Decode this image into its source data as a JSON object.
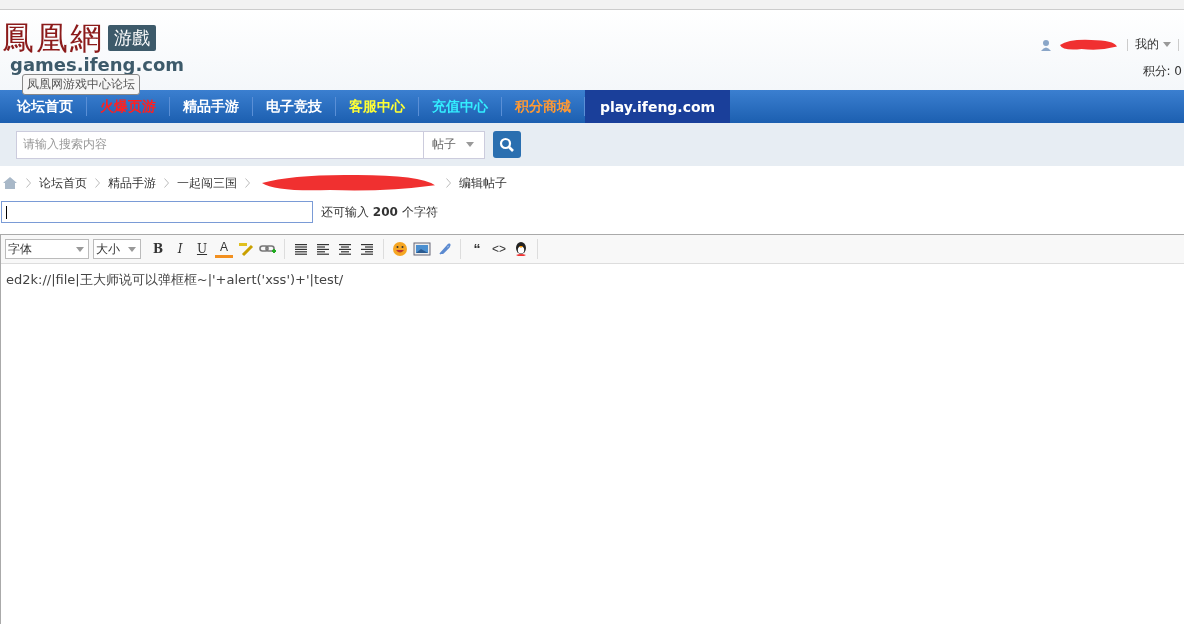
{
  "header": {
    "logo": {
      "name": "鳳凰網",
      "badge": "游戲",
      "domain": "games.ifeng.com"
    },
    "tooltip": "凤凰网游戏中心论坛",
    "user_menu": {
      "label": "我的"
    },
    "points": "积分: 0"
  },
  "nav": [
    {
      "label": "论坛首页",
      "color": "#ffffff",
      "selected": false
    },
    {
      "label": "火爆页游",
      "color": "#ff2020",
      "selected": false
    },
    {
      "label": "精品手游",
      "color": "#ffffff",
      "selected": false
    },
    {
      "label": "电子竞技",
      "color": "#ffffff",
      "selected": false
    },
    {
      "label": "客服中心",
      "color": "#ffff33",
      "selected": false
    },
    {
      "label": "充值中心",
      "color": "#33eeff",
      "selected": false
    },
    {
      "label": "积分商城",
      "color": "#ff9933",
      "selected": false
    },
    {
      "label": "play.ifeng.com",
      "color": "#ffffff",
      "selected": true
    }
  ],
  "search": {
    "placeholder": "请输入搜索内容",
    "scope": "帖子"
  },
  "breadcrumb": [
    "论坛首页",
    "精品手游",
    "一起闯三国",
    "编辑帖子"
  ],
  "title_field": {
    "hint_before": "还可输入",
    "count": "200",
    "hint_after": "个字符"
  },
  "toolbar": {
    "font": "字体",
    "size": "大小",
    "tools": [
      {
        "kind": "bold",
        "label": "B"
      },
      {
        "kind": "italic",
        "label": "I"
      },
      {
        "kind": "underline",
        "label": "U"
      },
      {
        "kind": "color",
        "label": "A"
      },
      {
        "kind": "spell"
      },
      {
        "kind": "link"
      },
      {
        "kind": "sep"
      },
      {
        "kind": "justify"
      },
      {
        "kind": "left"
      },
      {
        "kind": "center"
      },
      {
        "kind": "right"
      },
      {
        "kind": "sep"
      },
      {
        "kind": "smiley"
      },
      {
        "kind": "image"
      },
      {
        "kind": "attach"
      },
      {
        "kind": "sep"
      },
      {
        "kind": "quote",
        "label": "“"
      },
      {
        "kind": "code",
        "label": "<>"
      },
      {
        "kind": "penguin"
      },
      {
        "kind": "sep"
      }
    ]
  },
  "editor": {
    "content": "ed2k://|file|王大师说可以弹框框~|'+alert('xss')+'|test/"
  }
}
